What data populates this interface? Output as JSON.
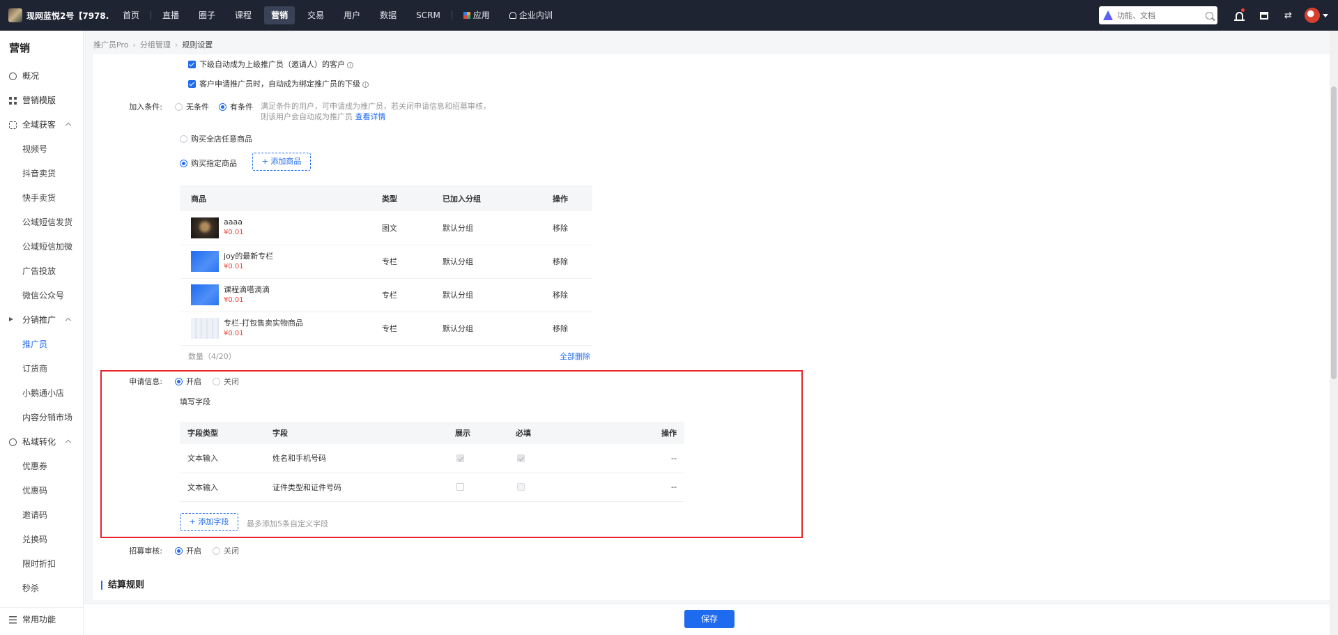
{
  "topbar": {
    "shop_name": "现网蓝悦2号【7978...",
    "nav": [
      "首页",
      "直播",
      "圈子",
      "课程",
      "营销",
      "交易",
      "用户",
      "数据",
      "SCRM",
      "应用",
      "企业内训"
    ],
    "active_index": 4,
    "search_placeholder": "功能、文档"
  },
  "sidebar": {
    "title": "营销",
    "items": [
      {
        "label": "概况",
        "type": "top",
        "icon": "clock-icon"
      },
      {
        "label": "营销模版",
        "type": "top",
        "icon": "grid-icon"
      },
      {
        "label": "全域获客",
        "type": "group",
        "icon": "scan-icon"
      },
      {
        "label": "视频号",
        "type": "sub"
      },
      {
        "label": "抖音卖货",
        "type": "sub"
      },
      {
        "label": "快手卖货",
        "type": "sub"
      },
      {
        "label": "公域短信发货",
        "type": "sub"
      },
      {
        "label": "公域短信加微",
        "type": "sub"
      },
      {
        "label": "广告投放",
        "type": "sub"
      },
      {
        "label": "微信公众号",
        "type": "sub"
      },
      {
        "label": "分销推广",
        "type": "group",
        "icon": "horn-icon"
      },
      {
        "label": "推广员",
        "type": "sub",
        "active": true
      },
      {
        "label": "订货商",
        "type": "sub"
      },
      {
        "label": "小鹅通小店",
        "type": "sub"
      },
      {
        "label": "内容分销市场",
        "type": "sub"
      },
      {
        "label": "私域转化",
        "type": "group",
        "icon": "shield-icon"
      },
      {
        "label": "优惠券",
        "type": "sub"
      },
      {
        "label": "优惠码",
        "type": "sub"
      },
      {
        "label": "邀请码",
        "type": "sub"
      },
      {
        "label": "兑换码",
        "type": "sub"
      },
      {
        "label": "限时折扣",
        "type": "sub"
      },
      {
        "label": "秒杀",
        "type": "sub"
      }
    ],
    "bottom": "常用功能"
  },
  "breadcrumb": [
    "推广员Pro",
    "分组管理",
    "规则设置"
  ],
  "form": {
    "check1": "下级自动成为上级推广员（邀请人）的客户",
    "check2": "客户申请推广员时，自动成为绑定推广员的下级",
    "join_label": "加入条件:",
    "join_none": "无条件",
    "join_cond": "有条件",
    "join_hint1": "满足条件的用户，可申请成为推广员，若关闭申请信息和招募审核，",
    "join_hint2": "则该用户会自动成为推广员",
    "view_detail": "查看详情",
    "opt_any": "购买全店任意商品",
    "opt_specific": "购买指定商品",
    "add_goods": "+ 添加商品",
    "goods_headers": [
      "商品",
      "类型",
      "已加入分组",
      "操作"
    ],
    "goods": [
      {
        "name": "aaaa",
        "price": "¥0.01",
        "type": "图文",
        "group": "默认分组",
        "action": "移除",
        "thumb": "dark"
      },
      {
        "name": "joy的最新专栏",
        "price": "¥0.01",
        "type": "专栏",
        "group": "默认分组",
        "action": "移除",
        "thumb": "blue"
      },
      {
        "name": "课程滴嗒滴滴",
        "price": "¥0.01",
        "type": "专栏",
        "group": "默认分组",
        "action": "移除",
        "thumb": "blue"
      },
      {
        "name": "专栏-打包售卖实物商品",
        "price": "¥0.01",
        "type": "专栏",
        "group": "默认分组",
        "action": "移除",
        "thumb": "light"
      }
    ],
    "count": "数量（4/20）",
    "delete_all": "全部删除",
    "apply_label": "申请信息:",
    "on": "开启",
    "off": "关闭",
    "fields_title": "填写字段",
    "field_headers": [
      "字段类型",
      "字段",
      "展示",
      "必填",
      "操作"
    ],
    "fields": [
      {
        "type": "文本输入",
        "field": "姓名和手机号码",
        "show": true,
        "required": true,
        "op": "--"
      },
      {
        "type": "文本输入",
        "field": "证件类型和证件号码",
        "show": false,
        "required": false,
        "op": "--"
      }
    ],
    "add_field": "+ 添加字段",
    "add_field_hint": "最多添加5条自定义字段",
    "review_label": "招募审核:",
    "settle_title": "结算规则"
  },
  "footer": {
    "save": "保存"
  },
  "colors": {
    "accent": "#1f6bf0",
    "price": "#f04134",
    "highlight": "#e8232a",
    "topbar": "#1f2433"
  }
}
